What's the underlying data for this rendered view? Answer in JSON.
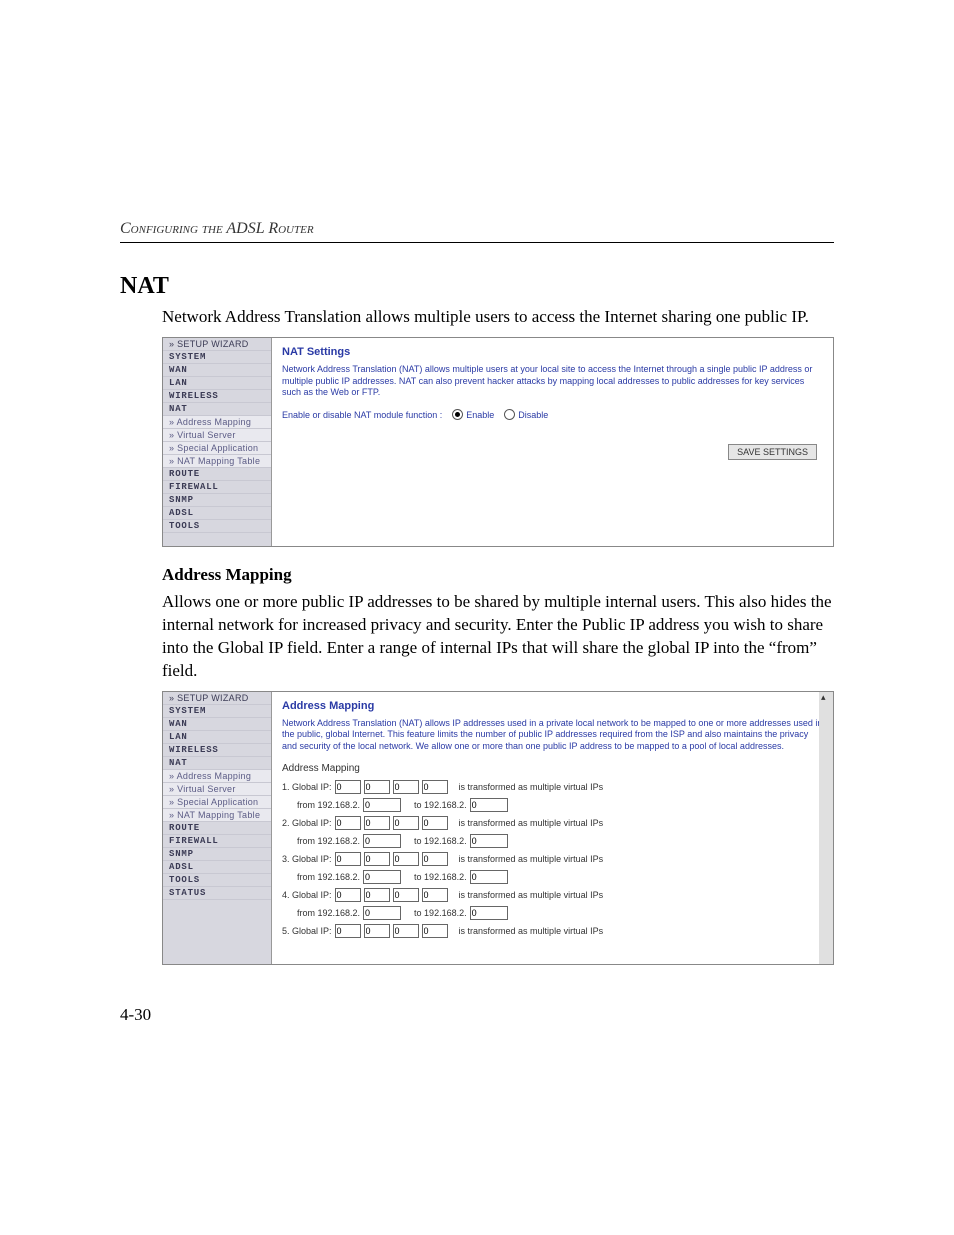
{
  "running_header": "Configuring the ADSL Router",
  "section": {
    "title": "NAT",
    "intro": "Network Address Translation allows multiple users to access the Internet sharing one public IP."
  },
  "screenshot1": {
    "sidebar": [
      "» SETUP WIZARD",
      "SYSTEM",
      "WAN",
      "LAN",
      "WIRELESS",
      "NAT",
      "» Address Mapping",
      "» Virtual Server",
      "» Special Application",
      "» NAT Mapping Table",
      "ROUTE",
      "FIREWALL",
      "SNMP",
      "ADSL",
      "TOOLS"
    ],
    "sidebar_major": [
      "SYSTEM",
      "WAN",
      "LAN",
      "WIRELESS",
      "NAT",
      "ROUTE",
      "FIREWALL",
      "SNMP",
      "ADSL",
      "TOOLS"
    ],
    "sidebar_sub": [
      "» Address Mapping",
      "» Virtual Server",
      "» Special Application",
      "» NAT Mapping Table"
    ],
    "title": "NAT Settings",
    "desc": "Network Address Translation (NAT) allows multiple users at your local site to access the Internet through a single public IP address or multiple public IP addresses. NAT can also prevent hacker attacks by mapping local addresses to public addresses for key services such as the Web or FTP.",
    "func_label": "Enable or disable NAT module function :",
    "enable_label": "Enable",
    "disable_label": "Disable",
    "save_label": "SAVE SETTINGS"
  },
  "subsection": {
    "title": "Address Mapping",
    "body": "Allows one or more public IP addresses to be shared by multiple internal users. This also hides the internal network for increased privacy and security. Enter the Public IP address you wish to share into the Global IP field. Enter a range of internal IPs that will share the global IP into the “from” field."
  },
  "screenshot2": {
    "sidebar": [
      "» SETUP WIZARD",
      "SYSTEM",
      "WAN",
      "LAN",
      "WIRELESS",
      "NAT",
      "» Address Mapping",
      "» Virtual Server",
      "» Special Application",
      "» NAT Mapping Table",
      "ROUTE",
      "FIREWALL",
      "SNMP",
      "ADSL",
      "TOOLS",
      "STATUS"
    ],
    "sidebar_major": [
      "SYSTEM",
      "WAN",
      "LAN",
      "WIRELESS",
      "NAT",
      "ROUTE",
      "FIREWALL",
      "SNMP",
      "ADSL",
      "TOOLS",
      "STATUS"
    ],
    "sidebar_sub": [
      "» Address Mapping",
      "» Virtual Server",
      "» Special Application",
      "» NAT Mapping Table"
    ],
    "title": "Address Mapping",
    "desc": "Network Address Translation (NAT) allows IP addresses used in a private local network to be mapped to one or more addresses used in the public, global Internet. This feature limits the number of public IP addresses required from the ISP and also maintains the privacy and security of the local network. We allow one or more than one public IP address to be mapped to a pool of local addresses.",
    "subheading": "Address Mapping",
    "global_ip_prefix": "Global IP:",
    "transformed_text": "is transformed as multiple virtual IPs",
    "from_prefix": "from 192.168.2.",
    "to_prefix": "to 192.168.2.",
    "rows": [
      1,
      2,
      3,
      4,
      5
    ],
    "ip_value": "0"
  },
  "page_number": "4-30"
}
